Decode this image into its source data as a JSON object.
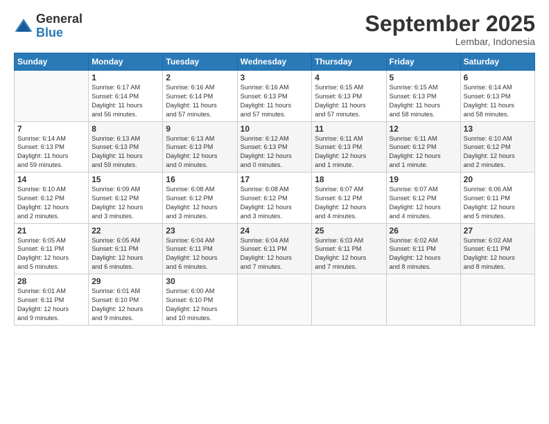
{
  "header": {
    "logo_general": "General",
    "logo_blue": "Blue",
    "month": "September 2025",
    "location": "Lembar, Indonesia"
  },
  "days_of_week": [
    "Sunday",
    "Monday",
    "Tuesday",
    "Wednesday",
    "Thursday",
    "Friday",
    "Saturday"
  ],
  "weeks": [
    [
      {
        "day": "",
        "info": ""
      },
      {
        "day": "1",
        "info": "Sunrise: 6:17 AM\nSunset: 6:14 PM\nDaylight: 11 hours\nand 56 minutes."
      },
      {
        "day": "2",
        "info": "Sunrise: 6:16 AM\nSunset: 6:14 PM\nDaylight: 11 hours\nand 57 minutes."
      },
      {
        "day": "3",
        "info": "Sunrise: 6:16 AM\nSunset: 6:13 PM\nDaylight: 11 hours\nand 57 minutes."
      },
      {
        "day": "4",
        "info": "Sunrise: 6:15 AM\nSunset: 6:13 PM\nDaylight: 11 hours\nand 57 minutes."
      },
      {
        "day": "5",
        "info": "Sunrise: 6:15 AM\nSunset: 6:13 PM\nDaylight: 11 hours\nand 58 minutes."
      },
      {
        "day": "6",
        "info": "Sunrise: 6:14 AM\nSunset: 6:13 PM\nDaylight: 11 hours\nand 58 minutes."
      }
    ],
    [
      {
        "day": "7",
        "info": "Sunrise: 6:14 AM\nSunset: 6:13 PM\nDaylight: 11 hours\nand 59 minutes."
      },
      {
        "day": "8",
        "info": "Sunrise: 6:13 AM\nSunset: 6:13 PM\nDaylight: 11 hours\nand 59 minutes."
      },
      {
        "day": "9",
        "info": "Sunrise: 6:13 AM\nSunset: 6:13 PM\nDaylight: 12 hours\nand 0 minutes."
      },
      {
        "day": "10",
        "info": "Sunrise: 6:12 AM\nSunset: 6:13 PM\nDaylight: 12 hours\nand 0 minutes."
      },
      {
        "day": "11",
        "info": "Sunrise: 6:11 AM\nSunset: 6:13 PM\nDaylight: 12 hours\nand 1 minute."
      },
      {
        "day": "12",
        "info": "Sunrise: 6:11 AM\nSunset: 6:12 PM\nDaylight: 12 hours\nand 1 minute."
      },
      {
        "day": "13",
        "info": "Sunrise: 6:10 AM\nSunset: 6:12 PM\nDaylight: 12 hours\nand 2 minutes."
      }
    ],
    [
      {
        "day": "14",
        "info": "Sunrise: 6:10 AM\nSunset: 6:12 PM\nDaylight: 12 hours\nand 2 minutes."
      },
      {
        "day": "15",
        "info": "Sunrise: 6:09 AM\nSunset: 6:12 PM\nDaylight: 12 hours\nand 3 minutes."
      },
      {
        "day": "16",
        "info": "Sunrise: 6:08 AM\nSunset: 6:12 PM\nDaylight: 12 hours\nand 3 minutes."
      },
      {
        "day": "17",
        "info": "Sunrise: 6:08 AM\nSunset: 6:12 PM\nDaylight: 12 hours\nand 3 minutes."
      },
      {
        "day": "18",
        "info": "Sunrise: 6:07 AM\nSunset: 6:12 PM\nDaylight: 12 hours\nand 4 minutes."
      },
      {
        "day": "19",
        "info": "Sunrise: 6:07 AM\nSunset: 6:12 PM\nDaylight: 12 hours\nand 4 minutes."
      },
      {
        "day": "20",
        "info": "Sunrise: 6:06 AM\nSunset: 6:11 PM\nDaylight: 12 hours\nand 5 minutes."
      }
    ],
    [
      {
        "day": "21",
        "info": "Sunrise: 6:05 AM\nSunset: 6:11 PM\nDaylight: 12 hours\nand 5 minutes."
      },
      {
        "day": "22",
        "info": "Sunrise: 6:05 AM\nSunset: 6:11 PM\nDaylight: 12 hours\nand 6 minutes."
      },
      {
        "day": "23",
        "info": "Sunrise: 6:04 AM\nSunset: 6:11 PM\nDaylight: 12 hours\nand 6 minutes."
      },
      {
        "day": "24",
        "info": "Sunrise: 6:04 AM\nSunset: 6:11 PM\nDaylight: 12 hours\nand 7 minutes."
      },
      {
        "day": "25",
        "info": "Sunrise: 6:03 AM\nSunset: 6:11 PM\nDaylight: 12 hours\nand 7 minutes."
      },
      {
        "day": "26",
        "info": "Sunrise: 6:02 AM\nSunset: 6:11 PM\nDaylight: 12 hours\nand 8 minutes."
      },
      {
        "day": "27",
        "info": "Sunrise: 6:02 AM\nSunset: 6:11 PM\nDaylight: 12 hours\nand 8 minutes."
      }
    ],
    [
      {
        "day": "28",
        "info": "Sunrise: 6:01 AM\nSunset: 6:11 PM\nDaylight: 12 hours\nand 9 minutes."
      },
      {
        "day": "29",
        "info": "Sunrise: 6:01 AM\nSunset: 6:10 PM\nDaylight: 12 hours\nand 9 minutes."
      },
      {
        "day": "30",
        "info": "Sunrise: 6:00 AM\nSunset: 6:10 PM\nDaylight: 12 hours\nand 10 minutes."
      },
      {
        "day": "",
        "info": ""
      },
      {
        "day": "",
        "info": ""
      },
      {
        "day": "",
        "info": ""
      },
      {
        "day": "",
        "info": ""
      }
    ]
  ]
}
